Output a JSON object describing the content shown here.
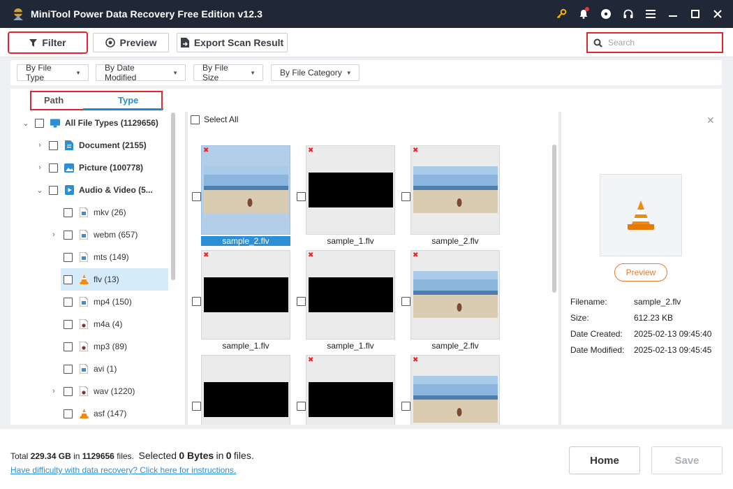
{
  "app": {
    "title": "MiniTool Power Data Recovery Free Edition v12.3"
  },
  "titlebar": {
    "icons": [
      "key-icon",
      "bell-icon",
      "disc-icon",
      "headset-icon",
      "menu-icon",
      "minimize-icon",
      "maximize-icon",
      "close-icon"
    ]
  },
  "toolbar": {
    "filter_label": "Filter",
    "preview_label": "Preview",
    "export_label": "Export Scan Result",
    "search_placeholder": "Search"
  },
  "filters": {
    "by_type": "By File Type",
    "by_date": "By Date Modified",
    "by_size": "By File Size",
    "by_category": "By File Category"
  },
  "tabs": {
    "path": "Path",
    "type": "Type",
    "active": "Type"
  },
  "tree": {
    "root": "All File Types (1129656)",
    "document": "Document (2155)",
    "picture": "Picture (100778)",
    "audio_video": "Audio & Video (5...",
    "mkv": "mkv (26)",
    "webm": "webm (657)",
    "mts": "mts (149)",
    "flv": "flv (13)",
    "mp4": "mp4 (150)",
    "m4a": "m4a (4)",
    "mp3": "mp3 (89)",
    "avi": "avi (1)",
    "wav": "wav (1220)",
    "asf": "asf (147)"
  },
  "grid": {
    "select_all": "Select All",
    "files": [
      "sample_2.flv",
      "sample_1.flv",
      "sample_2.flv",
      "sample_1.flv",
      "sample_1.flv",
      "sample_2.flv"
    ]
  },
  "preview_pane": {
    "button": "Preview",
    "filename_label": "Filename:",
    "filename": "sample_2.flv",
    "size_label": "Size:",
    "size": "612.23 KB",
    "created_label": "Date Created:",
    "created": "2025-02-13 09:45:40",
    "modified_label": "Date Modified:",
    "modified": "2025-02-13 09:45:45"
  },
  "footer": {
    "total_label": "Total",
    "total_size": "229.34 GB",
    "in_label": "in",
    "total_files": "1129656",
    "files_label": "files.",
    "selected_label": "Selected",
    "selected_size": "0 Bytes",
    "in2_label": "in",
    "selected_files": "0",
    "files2_label": "files.",
    "help_link": "Have difficulty with data recovery? Click here for instructions.",
    "home_label": "Home",
    "save_label": "Save"
  },
  "colors": {
    "accent": "#2c8fd6",
    "highlight": "#e0262c",
    "titlebar": "#202838",
    "preview_button": "#e6792c"
  }
}
